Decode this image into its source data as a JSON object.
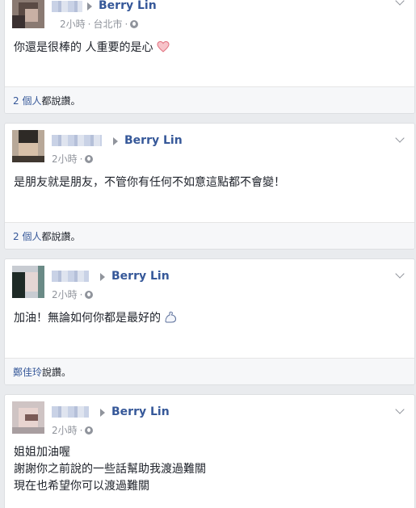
{
  "posts": [
    {
      "author_name": "",
      "target_name": "Berry Lin",
      "time": "2小時",
      "location": "台北市",
      "text_lines": [
        "你還是很棒的 人重要的是心"
      ],
      "likes_link": "2 個人",
      "likes_suffix": "都說讚。",
      "emoji": "heart"
    },
    {
      "author_name": "",
      "target_name": "Berry Lin",
      "time": "2小時",
      "location": "",
      "text_lines": [
        "是朋友就是朋友，不管你有任何不如意這點都不會變！"
      ],
      "likes_link": "2 個人",
      "likes_suffix": "都說讚。",
      "emoji": ""
    },
    {
      "author_name": "",
      "target_name": "Berry Lin",
      "time": "2小時",
      "location": "",
      "text_lines": [
        "加油！無論如何你都是最好的"
      ],
      "likes_link": "鄭佳玲",
      "likes_suffix": "說讚。",
      "emoji": "muscle"
    },
    {
      "author_name": "",
      "target_name": "Berry Lin",
      "time": "2小時",
      "location": "",
      "text_lines": [
        "姐姐加油喔",
        "謝謝你之前說的一些話幫助我渡過難關",
        "現在也希望你可以渡過難關"
      ],
      "likes_link": "",
      "likes_suffix": "",
      "emoji": ""
    }
  ],
  "colors": {
    "link": "#365899",
    "meta": "#90949c",
    "background": "#e9ebee"
  }
}
